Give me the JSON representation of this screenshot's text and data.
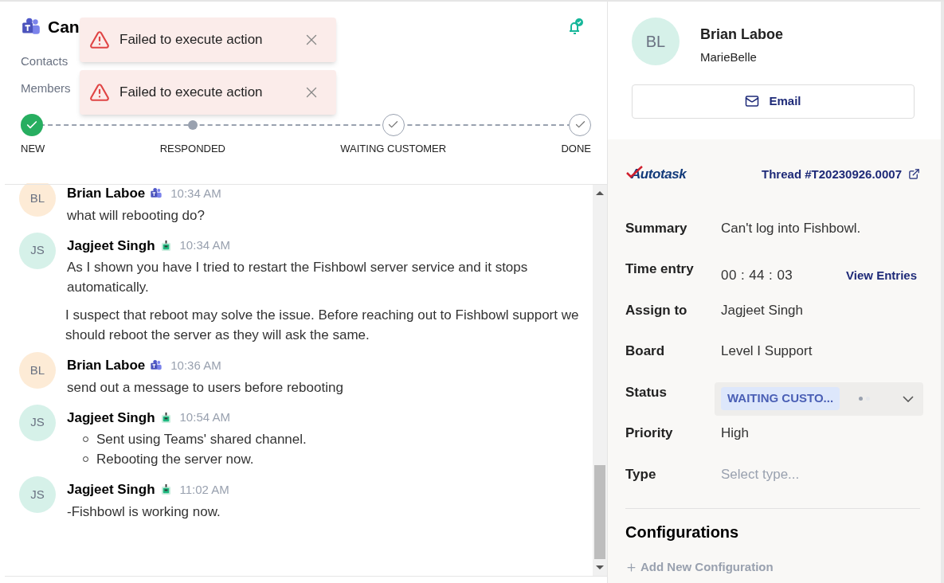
{
  "ticket": {
    "title": "Can",
    "contacts_label": "Contacts",
    "members_label": "Members"
  },
  "toasts": [
    {
      "message": "Failed to execute action"
    },
    {
      "message": "Failed to execute action"
    }
  ],
  "stepper": [
    {
      "label": "NEW",
      "completed": true,
      "current": false
    },
    {
      "label": "RESPONDED",
      "completed": false,
      "current": true
    },
    {
      "label": "WAITING CUSTOMER",
      "completed": false,
      "current": false
    },
    {
      "label": "DONE",
      "completed": false,
      "current": false
    }
  ],
  "messages": [
    {
      "initials": "BL",
      "color": "#fdebd6",
      "author": "Brian Laboe",
      "kind": "teams",
      "time": "10:34 AM",
      "blocks": [
        {
          "kind": "paragraph",
          "text": "what will rebooting do?"
        }
      ]
    },
    {
      "initials": "JS",
      "color": "#d6f1e9",
      "author": "Jagjeet Singh",
      "kind": "bot",
      "time": "10:34 AM",
      "blocks": [
        {
          "kind": "paragraph",
          "text": "As I shown you have I tried to restart the Fishbowl server service and it stops automatically."
        },
        {
          "kind": "paragraph",
          "text": "I suspect that reboot may solve the issue. Before reaching out to Fishbowl support we should reboot the server as they will ask the same."
        }
      ]
    },
    {
      "initials": "BL",
      "color": "#fdebd6",
      "author": "Brian Laboe",
      "kind": "teams",
      "time": "10:36 AM",
      "blocks": [
        {
          "kind": "paragraph",
          "text": "send out a message to users before rebooting"
        }
      ]
    },
    {
      "initials": "JS",
      "color": "#d6f1e9",
      "author": "Jagjeet Singh",
      "kind": "bot",
      "time": "10:54 AM",
      "blocks": [
        {
          "kind": "bullets",
          "items": [
            "Sent using Teams' shared channel.",
            "Rebooting the server now."
          ]
        }
      ]
    },
    {
      "initials": "JS",
      "color": "#d6f1e9",
      "author": "Jagjeet Singh",
      "kind": "bot",
      "time": "11:02 AM",
      "blocks": [
        {
          "kind": "paragraph",
          "text": "-Fishbowl is working now."
        }
      ]
    }
  ],
  "contact": {
    "initials": "BL",
    "name": "Brian Laboe",
    "company": "MarieBelle",
    "email_button": "Email"
  },
  "autotask": {
    "logo_text": "Autotask",
    "thread_link": "Thread #T20230926.0007",
    "fields": [
      {
        "kind": "text",
        "label": "Summary",
        "value": "Can't log into Fishbowl."
      },
      {
        "kind": "time",
        "label": "Time entry",
        "value": "00 : 44 : 03",
        "link": "View Entries"
      },
      {
        "kind": "text",
        "label": "Assign to",
        "value": "Jagjeet Singh"
      },
      {
        "kind": "text",
        "label": "Board",
        "value": "Level I Support"
      },
      {
        "kind": "status",
        "label": "Status",
        "value": "WAITING CUSTO..."
      },
      {
        "kind": "text",
        "label": "Priority",
        "value": "High"
      },
      {
        "kind": "placeholder",
        "label": "Type",
        "placeholder": "Select type..."
      }
    ],
    "configurations_title": "Configurations",
    "add_configuration": "Add New Configuration"
  }
}
